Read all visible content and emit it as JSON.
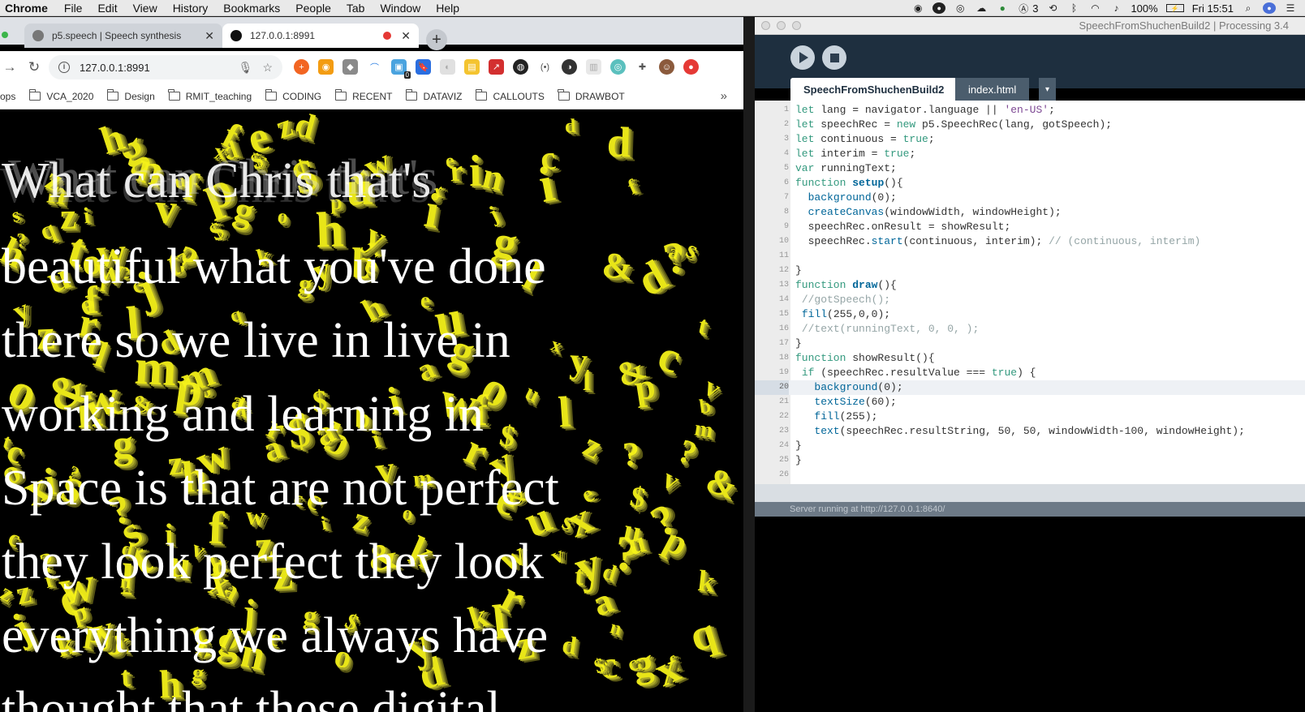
{
  "menubar": {
    "app": "Chrome",
    "items": [
      "File",
      "Edit",
      "View",
      "History",
      "Bookmarks",
      "People",
      "Tab",
      "Window",
      "Help"
    ],
    "status": {
      "adobe_count": "3",
      "battery": "100%",
      "clock": "Fri 15:51"
    }
  },
  "chrome": {
    "tabs": [
      {
        "title": "p5.speech | Speech synthesis"
      },
      {
        "title": "127.0.0.1:8991"
      }
    ],
    "address": "127.0.0.1:8991",
    "extension_badge": "0",
    "bookmarks": [
      "ops",
      "VCA_2020",
      "Design",
      "RMIT_teaching",
      "CODING",
      "RECENT",
      "DATAVIZ",
      "CALLOUTS",
      "DRAWBOT"
    ],
    "more_label": "»"
  },
  "canvas": {
    "ghost_text": "What can Chris that's",
    "caption_lines": [
      "beautiful what you've done",
      "there so we live in live in",
      "working and learning in",
      "Space is that are not perfect",
      "they look perfect they look",
      "everything we always have",
      "thought that these digital"
    ],
    "letter_color": "#f5f21a"
  },
  "processing": {
    "window_title": "SpeechFromShuchenBuild2 | Processing 3.4",
    "tabs": [
      "SpeechFromShuchenBuild2",
      "index.html"
    ],
    "tab_menu": "▾",
    "highlight_line": 20,
    "code": [
      "let lang = navigator.language || 'en-US';",
      "let speechRec = new p5.SpeechRec(lang, gotSpeech);",
      "let continuous = true;",
      "let interim = true;",
      "var runningText;",
      "function setup(){",
      "  background(0);",
      "  createCanvas(windowWidth, windowHeight);",
      "  speechRec.onResult = showResult;",
      "  speechRec.start(continuous, interim); // (continuous, interim)",
      "",
      "}",
      "function draw(){",
      " //gotSpeech();",
      " fill(255,0,0);",
      " //text(runningText, 0, 0, );",
      "}",
      "function showResult(){",
      " if (speechRec.resultValue === true) {",
      "   background(0);",
      "   textSize(60);",
      "   fill(255);",
      "   text(speechRec.resultString, 50, 50, windowWidth-100, windowHeight);",
      "}",
      "}",
      ""
    ],
    "status": "Server running at http://127.0.0.1:8640/"
  }
}
